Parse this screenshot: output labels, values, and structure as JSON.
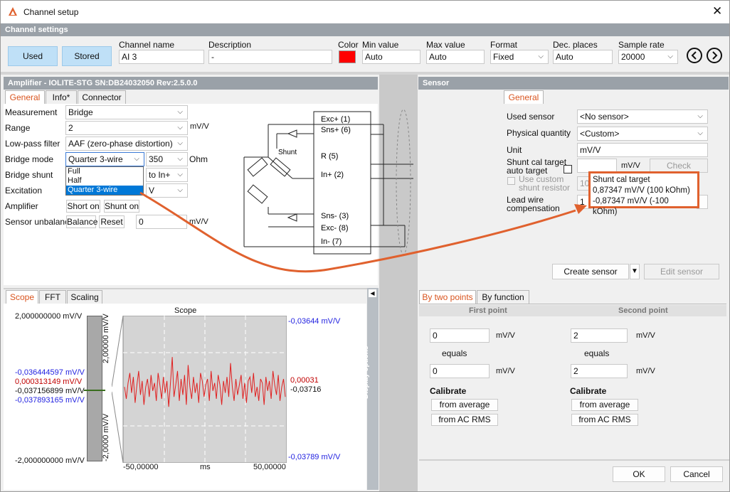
{
  "window": {
    "title": "Channel setup",
    "close": "✕"
  },
  "channel_settings": {
    "header": "Channel settings",
    "used": "Used",
    "stored": "Stored",
    "name_label": "Channel name",
    "name_value": "AI 3",
    "desc_label": "Description",
    "desc_value": "-",
    "color_label": "Color",
    "color": "#ff0000",
    "min_label": "Min value",
    "min_value": "Auto",
    "max_label": "Max value",
    "max_value": "Auto",
    "format_label": "Format",
    "format_value": "Fixed",
    "dec_label": "Dec. places",
    "dec_value": "Auto",
    "rate_label": "Sample rate",
    "rate_value": "20000"
  },
  "amplifier": {
    "header": "Amplifier - IOLITE-STG  SN:DB24032050 Rev:2.5.0.0",
    "tabs": [
      "General",
      "Info*",
      "Connector"
    ],
    "measurement_label": "Measurement",
    "measurement_value": "Bridge",
    "range_label": "Range",
    "range_value": "2",
    "range_unit": "mV/V",
    "lowpass_label": "Low-pass filter",
    "lowpass_value": "AAF (zero-phase distortion)",
    "bridgemode_label": "Bridge mode",
    "bridgemode_value": "Quarter 3-wire",
    "ohm_value": "350",
    "ohm_unit": "Ohm",
    "bridgeshunt_label": "Bridge shunt",
    "shunt_value": "to In+",
    "excitation_label": "Excitation",
    "excitation_value": "V",
    "amplifier_label": "Amplifier",
    "short_on": "Short on",
    "shunt_on": "Shunt on",
    "unbalance_label": "Sensor unbalance",
    "balance": "Balance",
    "reset": "Reset",
    "unbalance_value": "0",
    "unbalance_unit": "mV/V",
    "dropdown_options": [
      "Full",
      "Half",
      "Quarter 3-wire"
    ],
    "diagram": {
      "shunt": "Shunt",
      "exc_p": "Exc+ (1)",
      "sns_p": "Sns+ (6)",
      "r": "R (5)",
      "in_p": "In+ (2)",
      "sns_m": "Sns- (3)",
      "exc_m": "Exc- (8)",
      "in_m": "In- (7)"
    }
  },
  "sensor": {
    "header": "Sensor",
    "tab": "General",
    "used_label": "Used sensor",
    "used_value": "<No sensor>",
    "phys_label": "Physical quantity",
    "phys_value": "<Custom>",
    "unit_label": "Unit",
    "unit_value": "mV/V",
    "shunt_label_1": "Shunt cal target",
    "shunt_label_2": "auto target",
    "shunt_unit": "mV/V",
    "check": "Check",
    "custom_1": "Use custom",
    "custom_2": "shunt resistor",
    "custom_value": "100",
    "lead_label_1": "Lead wire",
    "lead_label_2": "compensation",
    "lead_value": "1",
    "tooltip": {
      "title": "Shunt cal target",
      "line1": "0,87347 mV/V (100 kOhm)",
      "line2": "-0,87347 mV/V (-100 kOhm)"
    },
    "create": "Create sensor",
    "edit": "Edit sensor"
  },
  "scope": {
    "tabs": [
      "Scope",
      "FFT",
      "Scaling"
    ],
    "title": "Scope",
    "top_left": "2,000000000 mV/V",
    "bottom_left": "-2,000000000 mV/V",
    "v_blue1": "-0,036444597 mV/V",
    "v_red": "0,000313149 mV/V",
    "v_black": "-0,037156899 mV/V",
    "v_blue2": "-0,037893165 mV/V",
    "bar_top": "2,00000 mV/V",
    "bar_bottom": "-2,0000 mV/V",
    "right_top": "-0,03644 mV/V",
    "right_red": "0,00031",
    "right_black": "-0,03716",
    "right_bottom": "-0,03789 mV/V",
    "x_left": "-50,00000",
    "x_mid": "ms",
    "x_right": "50,00000",
    "display_options": "Display options",
    "series": [
      0.1,
      -0.5,
      0.3,
      0.8,
      -0.2,
      0.6,
      -0.7,
      0.2,
      0.9,
      -0.3,
      0.4,
      -0.8,
      0.1,
      0.5,
      -0.4,
      0.7,
      -0.1,
      0.3,
      -0.6,
      0.8,
      0.2,
      -0.5,
      0.6,
      -0.2,
      0.4,
      -0.9,
      0.3,
      1.6,
      -0.4,
      0.2,
      0.9,
      -0.6,
      0.5,
      -0.3,
      0.7,
      -0.8,
      1.2,
      0.1,
      -0.5,
      0.6,
      -0.2,
      0.3,
      -0.7,
      0.8,
      0.4,
      -0.4,
      0.2,
      0.5,
      -0.6,
      0.9,
      -0.1,
      0.3,
      -0.5,
      0.7,
      0.2,
      -0.8,
      0.4,
      -0.2,
      0.6,
      -0.4,
      1.3,
      0.1,
      -0.6,
      0.5,
      -0.3,
      0.2,
      0.7,
      -0.5,
      0.3,
      -0.7,
      0.4,
      0.6,
      -0.2,
      0.8,
      -0.4,
      0.1,
      -0.6,
      0.5,
      0.3,
      -0.8,
      0.6,
      -0.1,
      0.4,
      -0.5,
      0.9,
      0.2,
      -0.3,
      0.7,
      -0.6,
      0.1,
      0.5,
      -0.4
    ]
  },
  "calibration": {
    "tabs": [
      "By two points",
      "By function"
    ],
    "first": "First point",
    "second": "Second point",
    "p1_in": "0",
    "p1_out": "0",
    "p2_in": "2",
    "p2_out": "2",
    "unit": "mV/V",
    "equals": "equals",
    "calibrate": "Calibrate",
    "avg": "from average",
    "rms": "from AC RMS"
  },
  "footer": {
    "ok": "OK",
    "cancel": "Cancel"
  },
  "colors": {
    "accent": "#d9541e",
    "blue": "#1f1fe0",
    "red": "#c00000",
    "callout": "#e0612e"
  }
}
